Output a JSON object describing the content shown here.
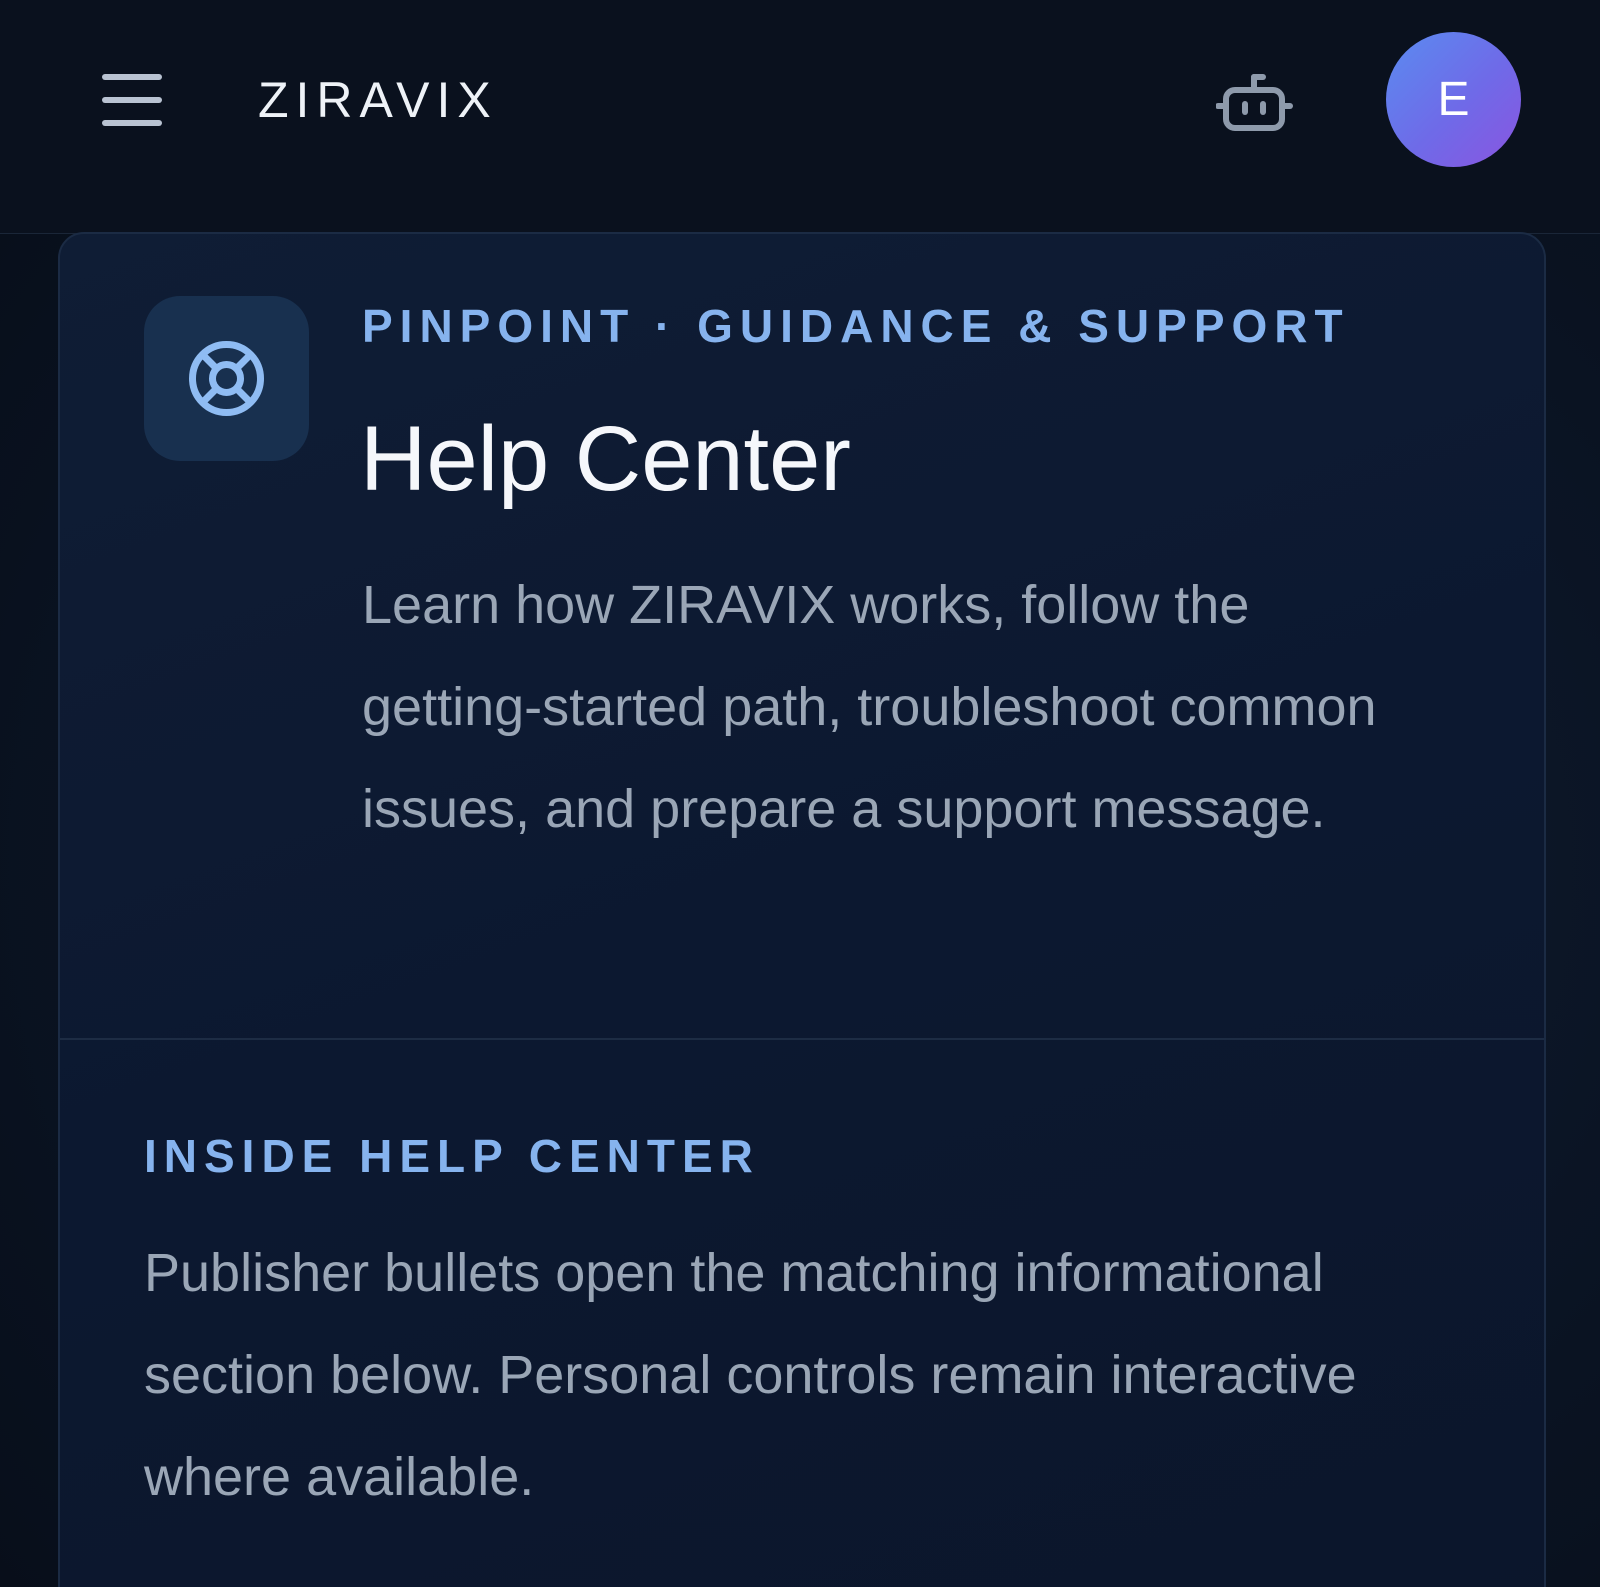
{
  "header": {
    "brand": "ZIRAVIX",
    "avatar_initial": "E",
    "menu_icon": "hamburger-menu-icon",
    "assistant_icon": "robot-icon"
  },
  "hero": {
    "icon": "lifebuoy-icon",
    "eyebrow": "PINPOINT · GUIDANCE & SUPPORT",
    "title": "Help Center",
    "description": "Learn how ZIRAVIX works, follow the getting-started path, troubleshoot common issues, and prepare a support message."
  },
  "inside": {
    "label": "INSIDE HELP CENTER",
    "body": "Publisher bullets open the matching informational section below. Personal controls remain interactive where available."
  },
  "colors": {
    "background": "#0a1220",
    "accent_label": "#86b3ee",
    "avatar_gradient_start": "#5a8cf0",
    "avatar_gradient_end": "#8a55e0"
  }
}
